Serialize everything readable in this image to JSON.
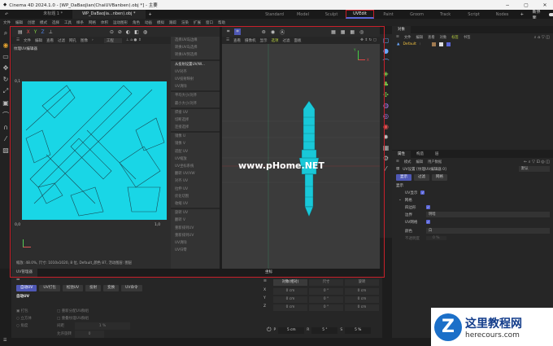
{
  "window": {
    "title": "Cinema 4D 2024.1.0 - [WP_DaBaoJian(ChaiUVBanben).obj *] - 主要",
    "minimize": "−",
    "maximize": "▢",
    "close": "✕"
  },
  "doc_tabs": [
    "未标题 1 *",
    "WP_DaBaoJia...nben).obj *"
  ],
  "add_tab": "+",
  "layouts": [
    "Standard",
    "Model",
    "Sculpt",
    "UVEdit",
    "Paint",
    "Groom",
    "Track",
    "Script",
    "Nodes"
  ],
  "active_layout": "UVEdit",
  "new_layout": "新界面",
  "menu": [
    "文件",
    "编辑",
    "创建",
    "模式",
    "选择",
    "工具",
    "样条",
    "网格",
    "体积",
    "运动图形",
    "角色",
    "动画",
    "模拟",
    "跟踪",
    "渲染",
    "扩展",
    "窗口",
    "帮助"
  ],
  "uv_editor": {
    "axes": [
      "X",
      "Y",
      "Z"
    ],
    "menu": [
      "文件",
      "编辑",
      "查看",
      "过滤",
      "网孔",
      "图像",
      "›"
    ],
    "layer": "工程",
    "title": "纹理UV编辑器",
    "labels": {
      "top": "0,1",
      "bottom_left": "0,0",
      "bottom_right": "1,0"
    },
    "status": "缩放: 48.0%, 尺寸: 1010x1020, 8 位, Default_颜色 87, 活动图层: 图层"
  },
  "commands": [
    "选择UV岛边缘",
    "转换UV岛选择",
    "转换UV到选择",
    "从投射设置UV/W...",
    "UV对齐",
    "UV投射映射",
    "UV清除",
    "平均大小/对齐",
    "最小大小/对齐",
    "焊接 UV",
    "切断选择",
    "连接选择",
    "镜像 U",
    "镜像 V",
    "适配 UV",
    "UV缩放",
    "UV坐标系统",
    "翻转 UV/VW",
    "对齐 UV",
    "拉伸 UV",
    "优化切割",
    "收缩 UV",
    "旋转 UV",
    "翻转 V",
    "重新排列UV",
    "重新排列UV",
    "UV清除",
    "UV归零"
  ],
  "viewport": {
    "menu": [
      "查看",
      "摄像机",
      "显示",
      "选项",
      "过滤",
      "面板"
    ],
    "watermark": "www.pHome.NET",
    "axis_x": "X",
    "axis_y": "Y"
  },
  "objects": {
    "tab": "对象",
    "menu": [
      "文件",
      "编辑",
      "查看",
      "对象",
      "标签",
      "书签"
    ],
    "item": "Default"
  },
  "attributes": {
    "tabs": [
      "属性",
      "构造",
      "层"
    ],
    "menu": [
      "模式",
      "编辑",
      "用户数据"
    ],
    "title": "UV设置 [纹理UV编辑器 0]",
    "preset": "默认",
    "subtabs": [
      "显示",
      "过滤",
      "网格"
    ],
    "section": "显示",
    "uv_display": "UV显示",
    "grid_group": "网格",
    "quads": "四边形",
    "border_label": "边界",
    "border_value": "明暗",
    "uv_grid": "UV网格",
    "color_label": "颜色",
    "color_value": "白",
    "opacity_label": "不透明度",
    "opacity_value": "0 %"
  },
  "uv_manager": {
    "tab": "UV管理器",
    "buttons": [
      "自动UV",
      "UV打包",
      "松弛UV",
      "投射",
      "变换",
      "UV命令"
    ],
    "section": "自动UV",
    "radios": [
      "打包",
      "立方体",
      "角度"
    ],
    "checks": [
      "重新分配UV群组",
      "重叠纹理UV群组"
    ],
    "spacing_label": "间距",
    "spacing_value": "1 %",
    "rotate_label": "允许旋转",
    "rotate_value": "0"
  },
  "coordinates": {
    "tab": "坐标",
    "header": [
      "对象(相对)",
      "尺寸",
      "旋转"
    ],
    "rows": [
      {
        "axis": "X",
        "pos": "0 cm",
        "rot": "0 °",
        "size": "0 cm"
      },
      {
        "axis": "Y",
        "pos": "0 cm",
        "rot": "0 °",
        "size": "0 cm"
      },
      {
        "axis": "Z",
        "pos": "0 cm",
        "rot": "0 °",
        "size": "0 cm"
      }
    ],
    "step": {
      "p_label": "P",
      "p": "5 cm",
      "r_label": "R",
      "r": "5 °",
      "s_label": "S",
      "s": "5 %"
    }
  },
  "brand": {
    "name": "这里教程网",
    "url": "herecours.com"
  },
  "colors": {
    "accent": "#5b66d8",
    "highlight": "#c8202a",
    "uv_fill": "#19d6e6"
  }
}
